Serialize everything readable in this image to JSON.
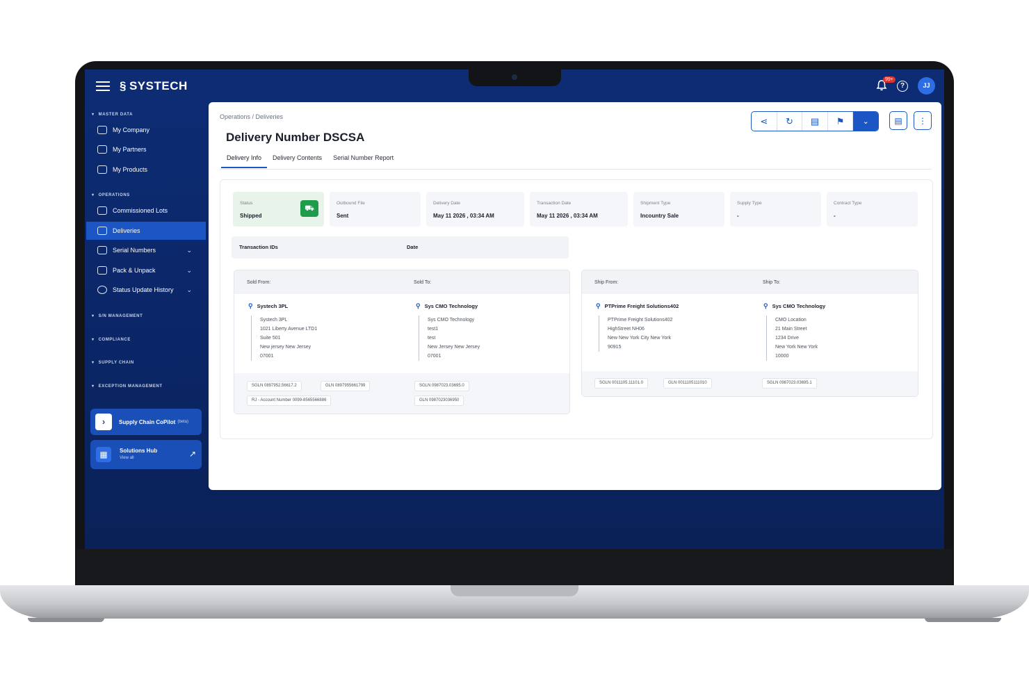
{
  "app": {
    "brand": "SYSTECH"
  },
  "topbar": {
    "notification_count": "99+",
    "help_label": "?",
    "avatar_initials": "JJ"
  },
  "sidebar": {
    "sections": {
      "master_data": "MASTER DATA",
      "operations": "OPERATIONS",
      "sn_management": "S/N MANAGEMENT",
      "compliance": "COMPLIANCE",
      "supply_chain": "SUPPLY CHAIN",
      "exception_management": "EXCEPTION MANAGEMENT"
    },
    "items": [
      {
        "label": "My Company"
      },
      {
        "label": "My Partners"
      },
      {
        "label": "My Products"
      },
      {
        "label": "Commissioned Lots"
      },
      {
        "label": "Deliveries"
      },
      {
        "label": "Serial Numbers"
      },
      {
        "label": "Pack & Unpack"
      },
      {
        "label": "Status Update History"
      }
    ],
    "copilot": {
      "label": "Supply Chain CoPilot",
      "badge": "(beta)"
    },
    "hub": {
      "title": "Solutions Hub",
      "subtitle": "View all"
    }
  },
  "page": {
    "breadcrumb": "Operations / Deliveries",
    "title": "Delivery Number DSCSA",
    "tabs": [
      "Delivery Info",
      "Delivery Contents",
      "Serial Number Report"
    ]
  },
  "toolbar": {
    "icons": [
      "share-icon",
      "refresh-icon",
      "report-icon",
      "flag-icon",
      "chevron-down-icon",
      "notes-icon",
      "more-vertical-icon"
    ]
  },
  "summary": [
    {
      "label": "Status",
      "value": "Shipped"
    },
    {
      "label": "Outbound File",
      "value": "Sent"
    },
    {
      "label": "Delivery Date",
      "value": "May 11 2026 , 03:34 AM"
    },
    {
      "label": "Transaction Date",
      "value": "May 11 2026 , 03:34 AM"
    },
    {
      "label": "Shipment Type",
      "value": "Incountry Sale"
    },
    {
      "label": "Supply Type",
      "value": "-"
    },
    {
      "label": "Contract Type",
      "value": "-"
    }
  ],
  "transactions": {
    "col_ids": "Transaction IDs",
    "col_date": "Date"
  },
  "sold": {
    "from_label": "Sold From:",
    "to_label": "Sold To:",
    "from": {
      "name": "Systech 3PL",
      "lines": [
        "Systech 3PL",
        "1021 Liberty Avenue LTD1",
        "Suite 501",
        "New jersey New Jersey",
        "07001"
      ],
      "tags": [
        "SGLN   0897952.56617.2",
        "GLN   0897955661799",
        "RJ - Account Number   0099-8565566886"
      ]
    },
    "to": {
      "name": "Sys CMO Technology",
      "lines": [
        "Sys CMO Technology",
        "test1",
        "test",
        "New Jersey New Jersey",
        "07001"
      ],
      "tags": [
        "SGLN   0987023.03695.0",
        "GLN   0987023036950"
      ]
    }
  },
  "ship": {
    "from_label": "Ship From:",
    "to_label": "Ship To:",
    "from": {
      "name": "PTPrime Freight Solutions402",
      "lines": [
        "PTPrime Freight Solutions402",
        "HighStreet NH06",
        "New New York City New York",
        "90915"
      ],
      "tags": [
        "SGLN   0011105.11101.0",
        "GLN   0011105111010"
      ]
    },
    "to": {
      "name": "Sys CMO Technology",
      "lines": [
        "CMO Location",
        "21 Main Street",
        "1234 Drive",
        "New York New York",
        "10000"
      ],
      "tags": [
        "SGLN   0987023.03695.1"
      ]
    }
  },
  "colors": {
    "navy": "#0d2c74",
    "accent": "#1b56c4",
    "status_green": "#1e9b4b"
  }
}
